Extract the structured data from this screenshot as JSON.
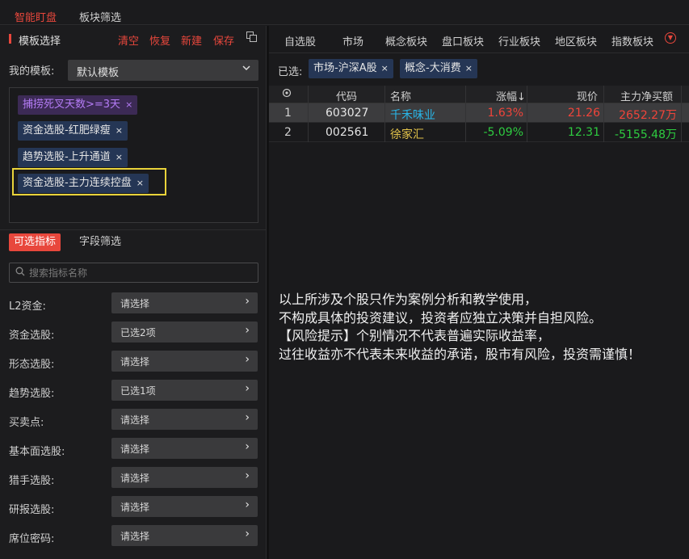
{
  "top_tabs": [
    "智能盯盘",
    "板块筛选"
  ],
  "template": {
    "title": "模板选择",
    "actions": [
      "清空",
      "恢复",
      "新建",
      "保存"
    ],
    "my_template_label": "我的模板:",
    "my_template_value": "默认模板",
    "conditions": [
      "捕捞死叉天数>=3天",
      "资金选股-红肥绿瘦",
      "趋势选股-上升通道",
      "资金选股-主力连续控盘"
    ],
    "remove_glyph": "×"
  },
  "sub_tabs": [
    "可选指标",
    "字段筛选"
  ],
  "search": {
    "placeholder": "搜索指标名称"
  },
  "fields": [
    {
      "label": "L2资金:",
      "value": "请选择"
    },
    {
      "label": "资金选股:",
      "value": "已选2项"
    },
    {
      "label": "形态选股:",
      "value": "请选择"
    },
    {
      "label": "趋势选股:",
      "value": "已选1项"
    },
    {
      "label": "买卖点:",
      "value": "请选择"
    },
    {
      "label": "基本面选股:",
      "value": "请选择"
    },
    {
      "label": "猎手选股:",
      "value": "请选择"
    },
    {
      "label": "研报选股:",
      "value": "请选择"
    },
    {
      "label": "席位密码:",
      "value": "请选择"
    }
  ],
  "market_tabs": [
    "自选股",
    "市场",
    "概念板块",
    "盘口板块",
    "行业板块",
    "地区板块",
    "指数板块"
  ],
  "selected": {
    "label": "已选:",
    "chips": [
      "市场-沪深A股",
      "概念-大消费"
    ]
  },
  "table": {
    "headers": [
      "代码",
      "名称",
      "涨幅↓",
      "现价",
      "主力净买额"
    ],
    "rows": [
      {
        "idx": "1",
        "code": "603027",
        "name": "千禾味业",
        "change": "1.63%",
        "price": "21.26",
        "net": "2652.27万"
      },
      {
        "idx": "2",
        "code": "002561",
        "name": "徐家汇",
        "change": "-5.09%",
        "price": "12.31",
        "net": "-5155.48万"
      }
    ]
  },
  "disclaimer": [
    "以上所涉及个股只作为案例分析和教学使用，",
    "不构成具体的投资建议，投资者应独立决策并自担风险。",
    "【风险提示】个别情况不代表普遍实际收益率，",
    "过往收益亦不代表未来收益的承诺，股市有风险，投资需谨慎！"
  ],
  "colors": {
    "accent": "#e8473c",
    "up": "#f0443a",
    "down": "#2ecc40",
    "name_link": "#29b6e8",
    "name_gold": "#e3c34a",
    "highlight": "#e9d33a"
  }
}
